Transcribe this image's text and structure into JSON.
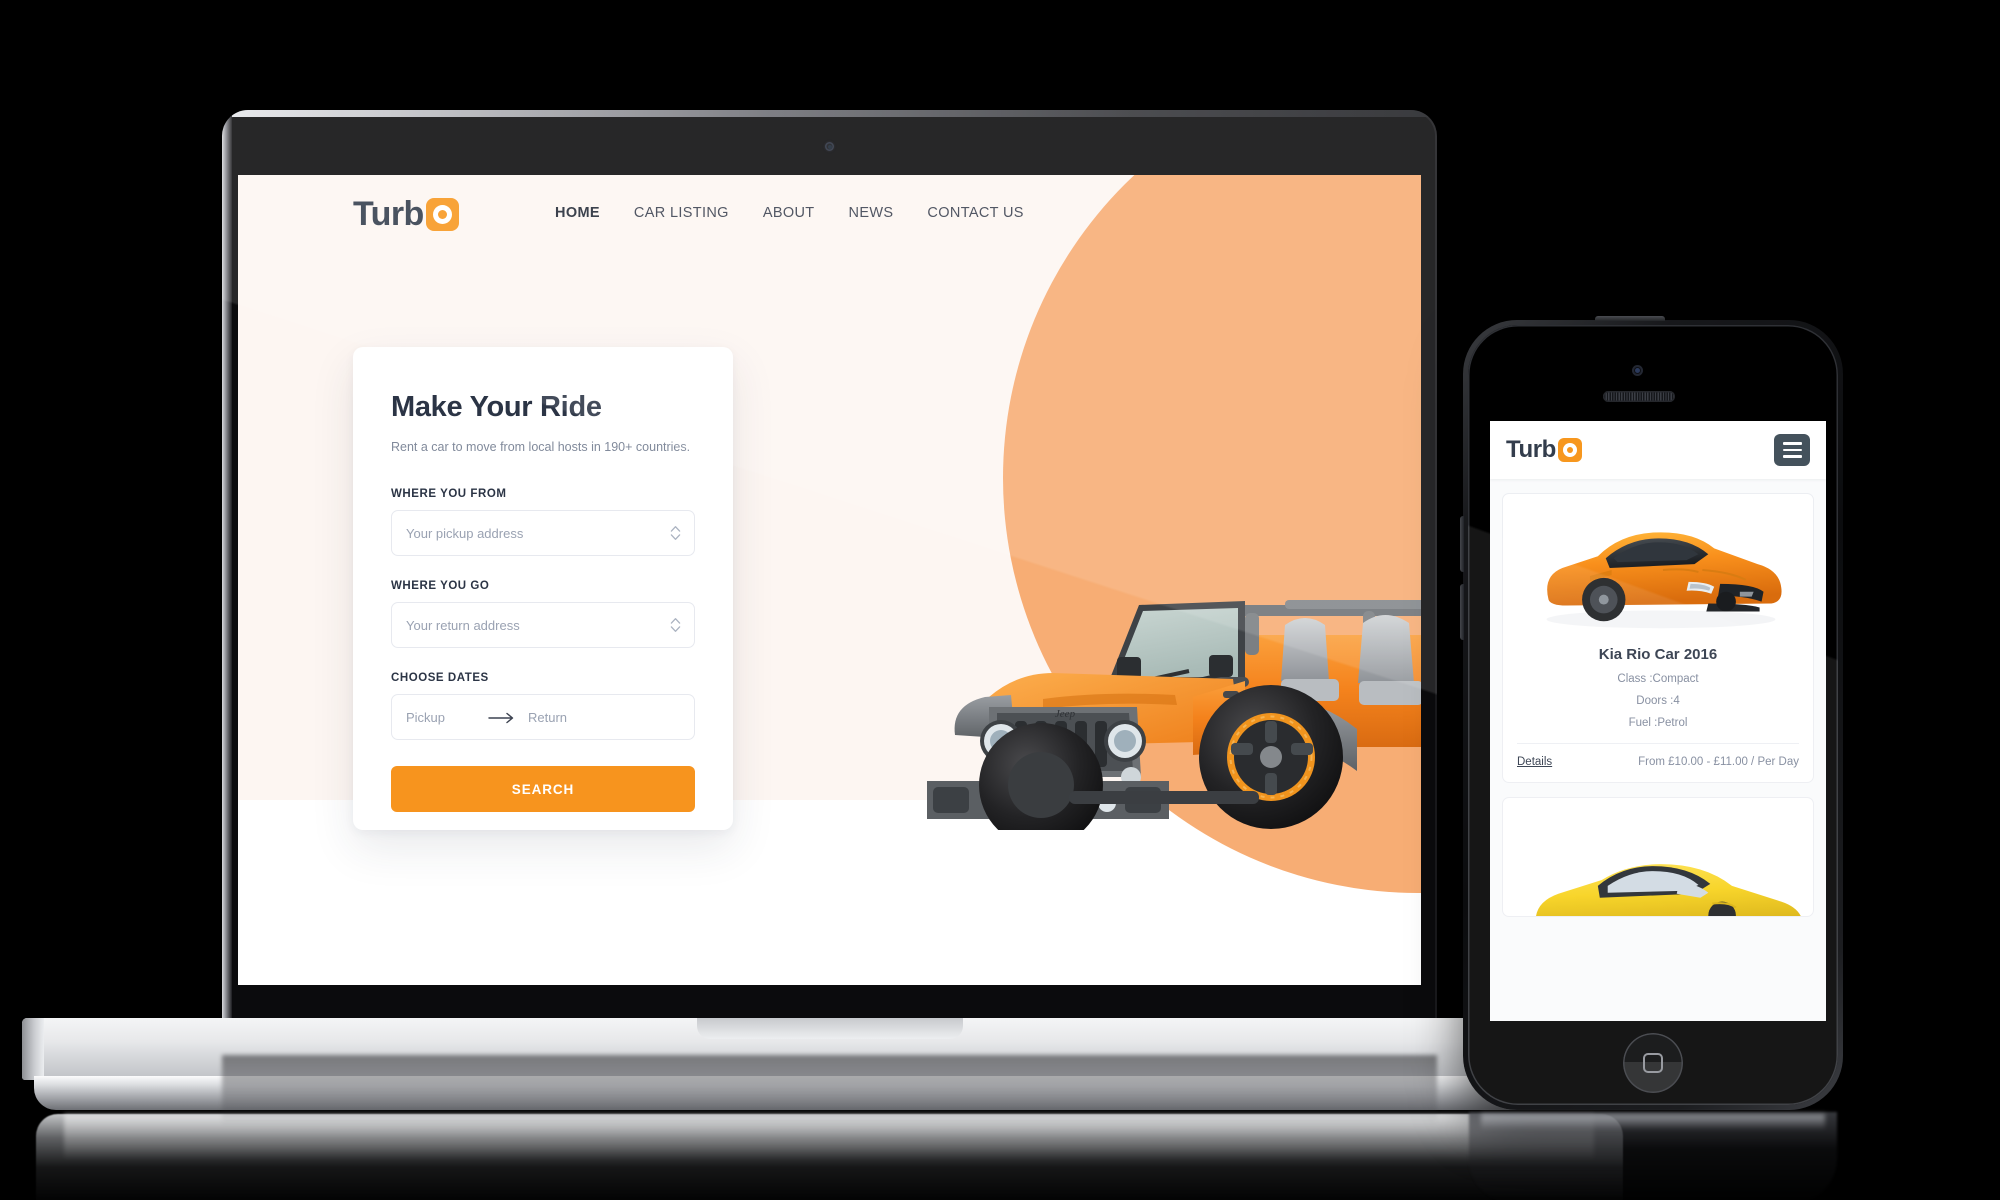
{
  "brand": {
    "name_prefix": "Turb",
    "logo_mark_icon": "turbo-o-icon",
    "accent_color": "#F7941E",
    "dark_color": "#333D4C"
  },
  "desktop": {
    "nav": [
      {
        "label": "HOME",
        "active": true
      },
      {
        "label": "CAR LISTING",
        "active": false
      },
      {
        "label": "ABOUT",
        "active": false
      },
      {
        "label": "NEWS",
        "active": false
      },
      {
        "label": "CONTACT US",
        "active": false
      }
    ],
    "hero": {
      "background_color": "#FDF6F2",
      "circle_color": "#F7AD74",
      "car_image": "orange-jeep-wrangler"
    },
    "form": {
      "title": "Make Your Ride",
      "subtitle": "Rent a car to move from local hosts in 190+ countries.",
      "fields": [
        {
          "label": "WHERE YOU FROM",
          "placeholder": "Your pickup address",
          "value": "",
          "icon": "stepper-chevrons-icon"
        },
        {
          "label": "WHERE YOU GO",
          "placeholder": "Your return address",
          "value": "",
          "icon": "stepper-chevrons-icon"
        }
      ],
      "dates": {
        "label": "CHOOSE DATES",
        "pickup_placeholder": "Pickup",
        "return_placeholder": "Return",
        "separator_icon": "arrow-right-icon"
      },
      "submit_label": "SEARCH"
    }
  },
  "mobile": {
    "header": {
      "menu_icon": "hamburger-menu-icon"
    },
    "cards": [
      {
        "image": "orange-ford-mustang",
        "title": "Kia Rio Car 2016",
        "specs": [
          "Class :Compact",
          "Doors :4",
          "Fuel :Petrol"
        ],
        "details_label": "Details",
        "price": "From  £10.00 - £11.00 / Per Day"
      },
      {
        "image": "yellow-sports-car",
        "title": "",
        "specs": [],
        "details_label": "",
        "price": ""
      }
    ]
  }
}
